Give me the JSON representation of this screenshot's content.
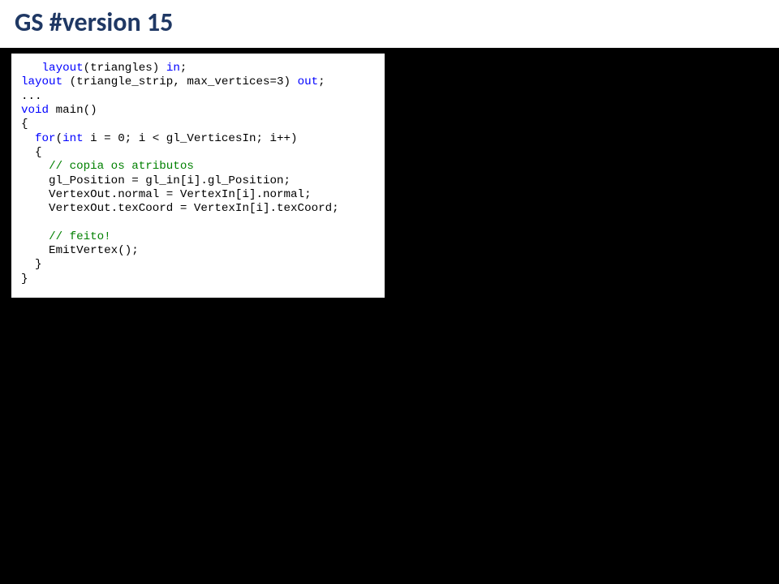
{
  "title": "GS #version 15",
  "code": {
    "l01a": "   ",
    "l01b": "layout",
    "l01c": "(triangles) ",
    "l01d": "in",
    "l01e": ";",
    "l02a": "layout",
    "l02b": " (triangle_strip, max_vertices=3) ",
    "l02c": "out",
    "l02d": ";",
    "l03a": "...",
    "l04a": "void",
    "l04b": " main()",
    "l05a": "{",
    "l06a": "  ",
    "l06b": "for",
    "l06c": "(",
    "l06d": "int",
    "l06e": " i = 0; i < gl_VerticesIn; i++)",
    "l07a": "  {",
    "l08a": "    ",
    "l08b": "// copia os atributos",
    "l09a": "    gl_Position = gl_in[i].gl_Position;",
    "l10a": "    VertexOut.normal = VertexIn[i].normal;",
    "l11a": "    VertexOut.texCoord = VertexIn[i].texCoord;",
    "l12a": " ",
    "l13a": "    ",
    "l13b": "// feito!",
    "l14a": "    EmitVertex();",
    "l15a": "  }",
    "l16a": "}"
  }
}
